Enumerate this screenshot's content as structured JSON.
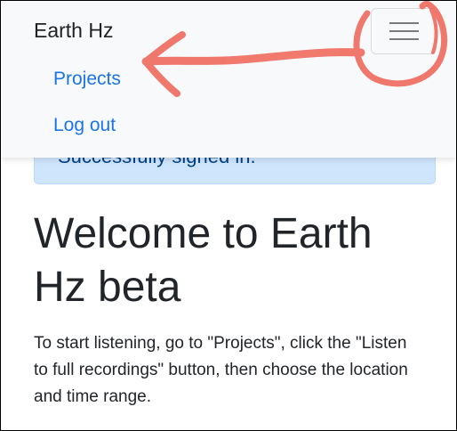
{
  "navbar": {
    "brand": "Earth Hz",
    "links": [
      {
        "label": "Projects"
      },
      {
        "label": "Log out"
      }
    ]
  },
  "alert": {
    "text": "Successfully signed in."
  },
  "main": {
    "title": "Welcome to Earth Hz beta",
    "intro": "To start listening, go to \"Projects\", click the \"Listen to full recordings\" button, then choose the location and time range."
  },
  "colors": {
    "link": "#1a74e8",
    "navbar_bg": "#f8f9fa",
    "alert_bg": "#cfe5fc",
    "annotation": "#ef6a5d"
  }
}
